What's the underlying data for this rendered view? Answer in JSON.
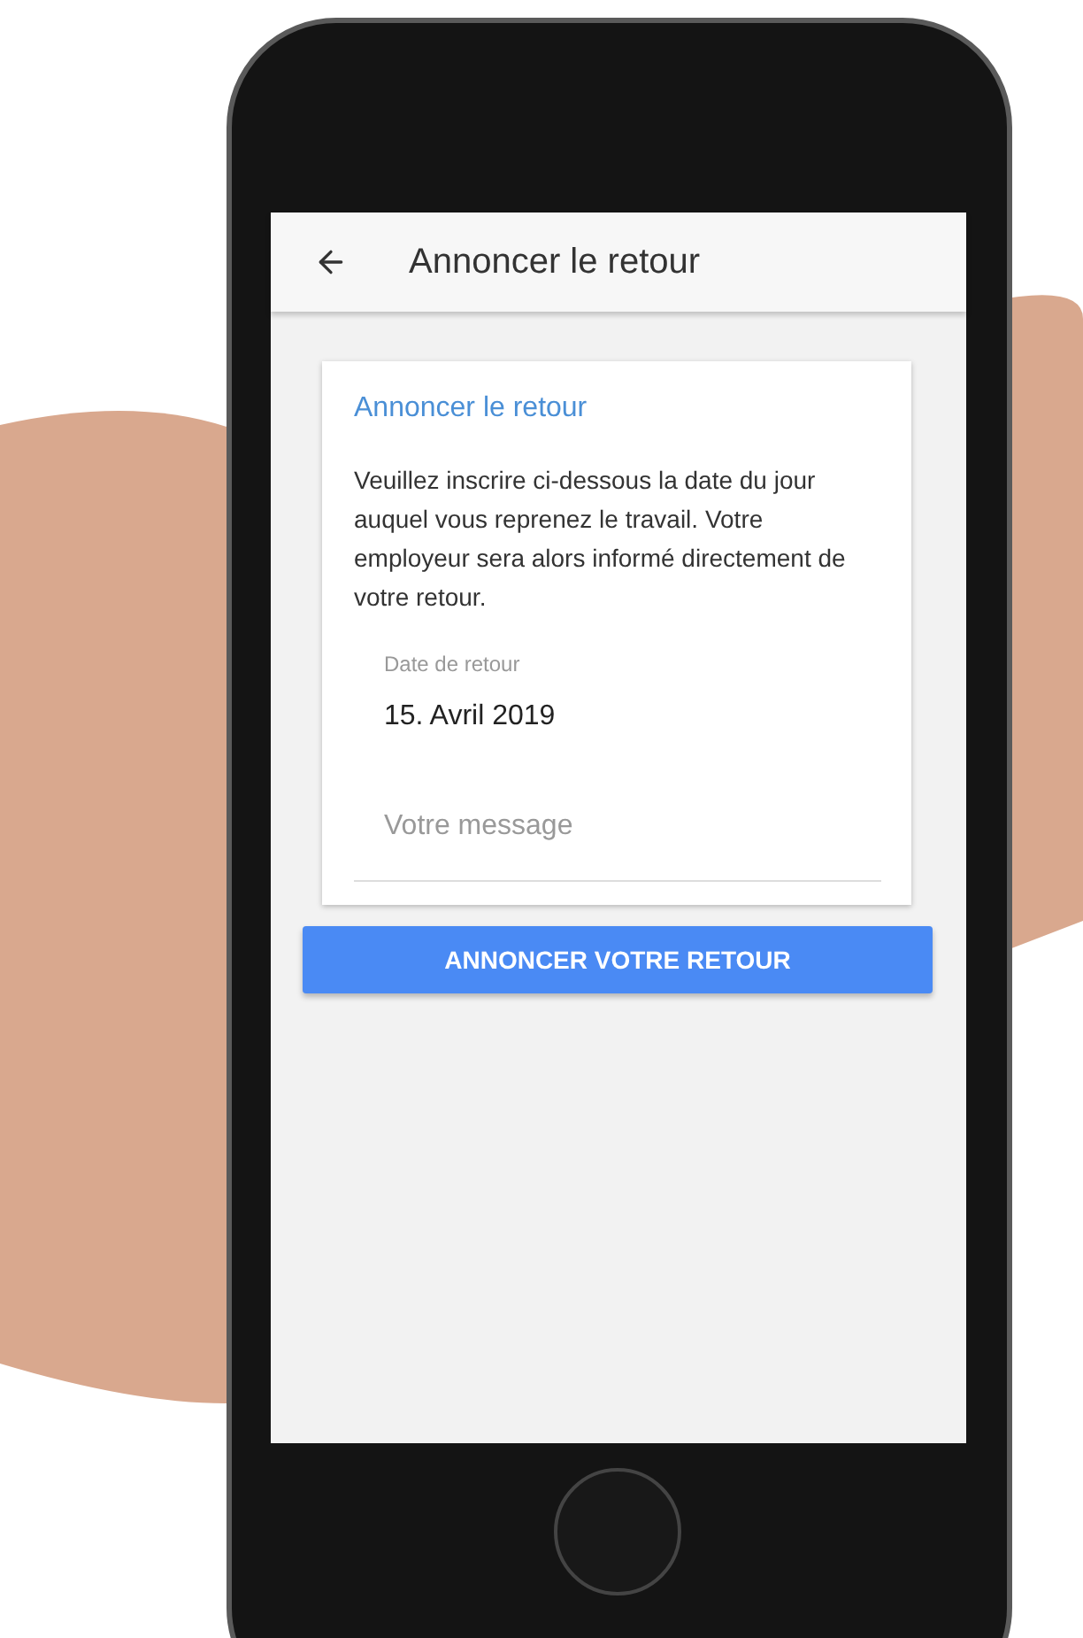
{
  "app_bar": {
    "title": "Annoncer le retour"
  },
  "card": {
    "title": "Annoncer le retour",
    "text": "Veuillez inscrire ci-dessous la date du jour auquel vous reprenez le travail. Votre employeur sera alors informé directement de votre retour.",
    "date_field": {
      "label": "Date de retour",
      "value": "15. Avril 2019"
    },
    "message_field": {
      "placeholder": "Votre message"
    }
  },
  "submit_button": {
    "label": "ANNONCER VOTRE RETOUR"
  }
}
